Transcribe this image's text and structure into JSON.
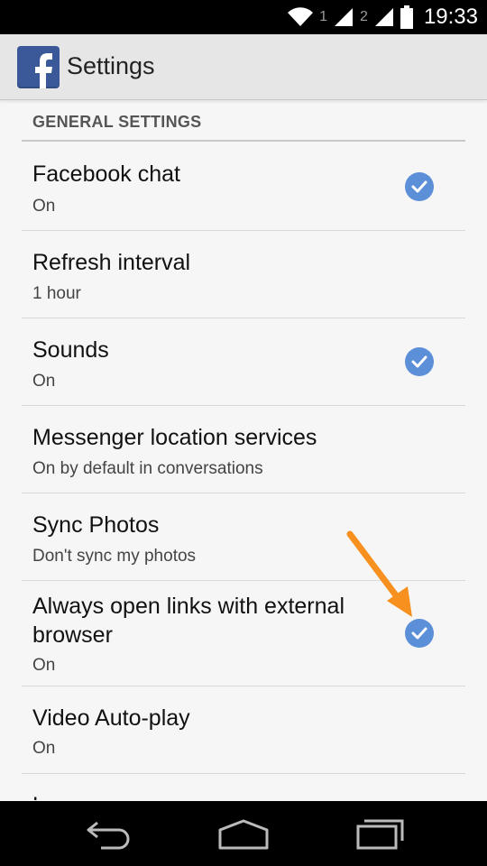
{
  "status_bar": {
    "sim1": "1",
    "sim2": "2",
    "time": "19:33",
    "icons": [
      "wifi-icon",
      "signal-icon",
      "signal-icon",
      "battery-icon"
    ]
  },
  "action_bar": {
    "app_icon": "facebook-icon",
    "title": "Settings"
  },
  "section": {
    "header": "GENERAL SETTINGS"
  },
  "settings": [
    {
      "title": "Facebook chat",
      "subtitle": "On",
      "checked": true
    },
    {
      "title": "Refresh interval",
      "subtitle": "1 hour",
      "checked": false
    },
    {
      "title": "Sounds",
      "subtitle": "On",
      "checked": true
    },
    {
      "title": "Messenger location services",
      "subtitle": "On by default in conversations",
      "checked": false
    },
    {
      "title": "Sync Photos",
      "subtitle": "Don't sync my photos",
      "checked": false
    },
    {
      "title": "Always open links with external browser",
      "subtitle": "On",
      "checked": true
    },
    {
      "title": "Video Auto-play",
      "subtitle": "On",
      "checked": false
    },
    {
      "title": "Language",
      "subtitle": "",
      "checked": false
    }
  ],
  "nav_bar": {
    "buttons": [
      "back-icon",
      "home-icon",
      "recents-icon"
    ]
  },
  "colors": {
    "check_blue": "#5b8fd8",
    "facebook_blue": "#3b5998",
    "annotation_orange": "#f7901e"
  }
}
